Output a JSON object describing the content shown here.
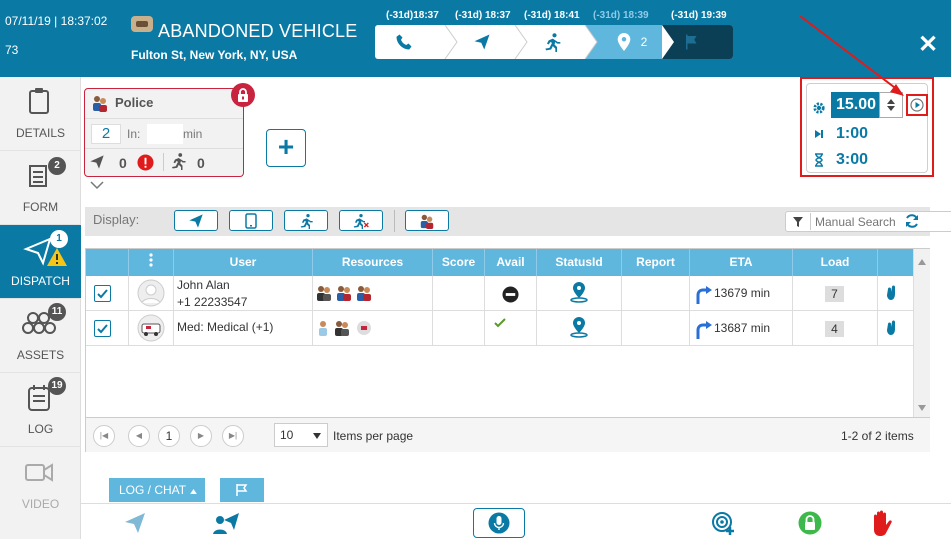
{
  "header": {
    "date": "07/11/19",
    "time": "18:37:02",
    "incident_number": "73",
    "title": "ABANDONED VEHICLE",
    "address": "Fulton St, New York, NY, USA",
    "timeline": [
      "(-31d)18:37",
      "(-31d) 18:37",
      "(-31d) 18:41",
      "(-31d) 18:39",
      "(-31d) 19:39"
    ],
    "location_step_count": "2",
    "close_symbol": "✕"
  },
  "sidebar": {
    "items": [
      {
        "label": "DETAILS",
        "badge": ""
      },
      {
        "label": "FORM",
        "badge": "2"
      },
      {
        "label": "DISPATCH",
        "badge": "1"
      },
      {
        "label": "ASSETS",
        "badge": "11"
      },
      {
        "label": "LOG",
        "badge": "19"
      },
      {
        "label": "VIDEO",
        "badge": ""
      }
    ]
  },
  "police_card": {
    "title": "Police",
    "count": "2",
    "in_label": "In:",
    "in_value": "",
    "min_label": "min",
    "sent_count": "0",
    "arrived_count": "0"
  },
  "timer": {
    "interval_value": "15.00",
    "next_value": "1:00",
    "elapsed_value": "3:00"
  },
  "display_bar": {
    "label": "Display:",
    "search_placeholder": "Manual Search"
  },
  "grid": {
    "columns": [
      "User",
      "Resources",
      "Score",
      "Avail",
      "StatusId",
      "Report",
      "ETA",
      "Load"
    ],
    "rows": [
      {
        "user_name": "John Alan",
        "user_phone": "+1 22233547",
        "eta": "13679 min",
        "load": "7"
      },
      {
        "user_name": "Med: Medical (+1)",
        "user_phone": "",
        "eta": "13687 min",
        "load": "4"
      }
    ],
    "pager": {
      "page": "1",
      "page_size": "10",
      "items_per_page_label": "Items per page",
      "summary": "1-2 of 2 items"
    }
  },
  "bottom": {
    "log_chat_label": "LOG / CHAT"
  },
  "colors": {
    "primary": "#0a7aa5",
    "grid_header": "#5fb7de",
    "alert_red": "#e01b1b",
    "lock_red": "#c9243f",
    "green": "#3cb94a"
  }
}
